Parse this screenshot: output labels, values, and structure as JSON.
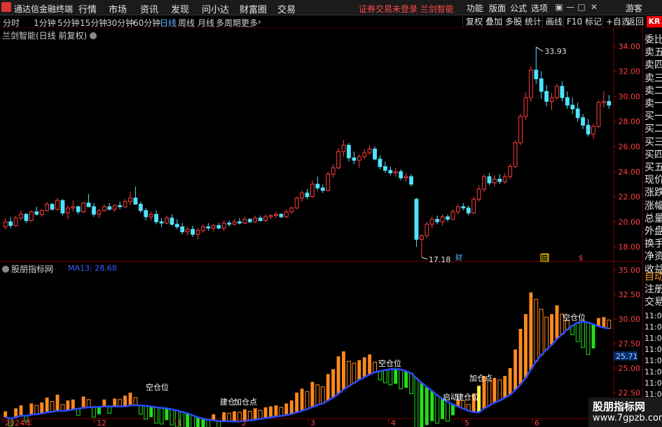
{
  "menubar": {
    "app_title": "通达信金融终端",
    "menus": [
      "行情",
      "市场",
      "资讯",
      "发现",
      "问小达",
      "财富圈",
      "交易"
    ],
    "status": "证券交易未登录  兰剑智能",
    "right_menus": [
      "功能",
      "版面",
      "公式",
      "选项"
    ],
    "user": "游客"
  },
  "periodbar": {
    "periods": [
      "分时",
      "1分钟",
      "5分钟",
      "15分钟",
      "30分钟",
      "60分钟",
      "日线",
      "周线",
      "月线",
      "多周期",
      "更多"
    ],
    "active_period": "日线",
    "tools": [
      "复权",
      "叠加",
      "多股",
      "统计",
      "画线",
      "F10",
      "标记",
      "+自选",
      "返回"
    ],
    "badge": "KR"
  },
  "main_panel": {
    "title": "兰剑智能(日线 前复权)"
  },
  "indicator_panel": {
    "title": "股朋指标网",
    "ma_label": "MA13: 28.68"
  },
  "chart_data": [
    {
      "type": "candlestick",
      "title": "兰剑智能(日线 前复权)",
      "ylim": [
        17,
        35
      ],
      "y_ticks": [
        "34.00",
        "32.00",
        "30.00",
        "28.00",
        "26.00",
        "24.00",
        "22.00",
        "20.00",
        "18.00"
      ],
      "y_tick_values": [
        34,
        32,
        30,
        28,
        26,
        24,
        22,
        20,
        18
      ],
      "annotations": [
        {
          "text": "33.93",
          "value": 33.93
        },
        {
          "text": "17.18",
          "value": 17.18
        }
      ],
      "markers": [
        "财",
        "回",
        "$"
      ],
      "candles": [
        [
          19.6,
          20.3,
          19.4,
          20.0
        ],
        [
          20.0,
          20.4,
          19.5,
          19.7
        ],
        [
          19.7,
          20.5,
          19.6,
          20.3
        ],
        [
          20.3,
          20.9,
          20.1,
          20.6
        ],
        [
          20.6,
          20.7,
          19.9,
          20.1
        ],
        [
          20.1,
          20.9,
          20.0,
          20.8
        ],
        [
          20.8,
          21.2,
          20.5,
          20.6
        ],
        [
          20.6,
          21.0,
          20.4,
          20.9
        ],
        [
          20.9,
          21.6,
          20.8,
          21.4
        ],
        [
          21.4,
          21.5,
          20.9,
          21.0
        ],
        [
          21.0,
          21.9,
          20.9,
          21.7
        ],
        [
          21.7,
          21.8,
          20.5,
          20.7
        ],
        [
          20.7,
          21.3,
          20.2,
          21.1
        ],
        [
          21.1,
          21.7,
          20.8,
          21.2
        ],
        [
          21.2,
          21.3,
          20.6,
          20.8
        ],
        [
          20.8,
          21.6,
          20.7,
          21.5
        ],
        [
          21.5,
          22.2,
          21.2,
          21.2
        ],
        [
          21.2,
          21.5,
          20.4,
          20.6
        ],
        [
          20.6,
          21.0,
          20.3,
          20.9
        ],
        [
          20.9,
          21.4,
          20.8,
          21.2
        ],
        [
          21.2,
          21.5,
          20.9,
          21.0
        ],
        [
          21.0,
          21.4,
          20.8,
          21.3
        ],
        [
          21.3,
          21.6,
          21.0,
          21.2
        ],
        [
          21.2,
          21.8,
          21.1,
          21.6
        ],
        [
          21.6,
          22.4,
          21.3,
          21.9
        ],
        [
          21.9,
          22.8,
          21.5,
          21.4
        ],
        [
          21.4,
          21.6,
          20.7,
          20.9
        ],
        [
          20.9,
          21.1,
          20.1,
          20.4
        ],
        [
          20.4,
          20.8,
          20.1,
          20.6
        ],
        [
          20.6,
          20.9,
          19.8,
          20.0
        ],
        [
          20.0,
          20.3,
          19.6,
          19.9
        ],
        [
          19.9,
          20.5,
          19.8,
          20.3
        ],
        [
          20.3,
          20.6,
          19.7,
          19.8
        ],
        [
          19.8,
          20.2,
          19.4,
          19.6
        ],
        [
          19.6,
          19.9,
          19.0,
          19.2
        ],
        [
          19.2,
          19.6,
          18.9,
          19.4
        ],
        [
          19.4,
          19.7,
          18.8,
          19.0
        ],
        [
          19.0,
          19.5,
          18.6,
          19.3
        ],
        [
          19.3,
          19.8,
          19.1,
          19.6
        ],
        [
          19.6,
          19.9,
          19.3,
          19.5
        ],
        [
          19.5,
          19.8,
          19.2,
          19.7
        ],
        [
          19.7,
          19.9,
          19.4,
          19.5
        ],
        [
          19.5,
          20.1,
          19.3,
          19.9
        ],
        [
          19.9,
          20.1,
          19.6,
          19.8
        ],
        [
          19.8,
          20.2,
          19.7,
          20.0
        ],
        [
          20.0,
          20.3,
          19.8,
          19.9
        ],
        [
          19.9,
          20.4,
          19.8,
          20.2
        ],
        [
          20.2,
          20.3,
          19.9,
          20.0
        ],
        [
          20.0,
          20.5,
          19.9,
          20.3
        ],
        [
          20.3,
          20.5,
          20.0,
          20.1
        ],
        [
          20.1,
          20.6,
          20.0,
          20.4
        ],
        [
          20.4,
          20.6,
          20.2,
          20.5
        ],
        [
          20.5,
          20.8,
          20.3,
          20.6
        ],
        [
          20.6,
          20.7,
          20.3,
          20.4
        ],
        [
          20.4,
          21.0,
          20.3,
          20.8
        ],
        [
          20.8,
          21.2,
          20.6,
          21.1
        ],
        [
          21.1,
          22.0,
          21.0,
          21.9
        ],
        [
          21.9,
          22.5,
          21.6,
          22.3
        ],
        [
          22.3,
          22.6,
          21.8,
          22.0
        ],
        [
          22.0,
          23.3,
          21.9,
          23.0
        ],
        [
          23.0,
          23.6,
          22.5,
          22.7
        ],
        [
          22.7,
          23.0,
          22.3,
          22.5
        ],
        [
          22.5,
          24.0,
          22.4,
          23.8
        ],
        [
          23.8,
          24.6,
          23.5,
          24.3
        ],
        [
          24.3,
          25.9,
          24.2,
          25.6
        ],
        [
          25.6,
          26.5,
          25.2,
          26.1
        ],
        [
          26.1,
          26.3,
          24.8,
          25.1
        ],
        [
          25.1,
          25.6,
          24.6,
          24.9
        ],
        [
          24.9,
          25.4,
          24.3,
          25.2
        ],
        [
          25.2,
          25.8,
          25.0,
          25.5
        ],
        [
          25.5,
          26.1,
          25.3,
          25.8
        ],
        [
          25.8,
          26.0,
          24.9,
          25.0
        ],
        [
          25.0,
          25.3,
          24.2,
          24.4
        ],
        [
          24.4,
          24.8,
          23.9,
          24.1
        ],
        [
          24.1,
          24.4,
          23.7,
          23.9
        ],
        [
          23.9,
          24.3,
          23.6,
          24.0
        ],
        [
          24.0,
          24.2,
          23.3,
          23.5
        ],
        [
          23.5,
          23.9,
          23.2,
          23.6
        ],
        [
          23.6,
          23.8,
          22.8,
          23.0
        ],
        [
          21.8,
          21.9,
          18.0,
          18.6
        ],
        [
          18.6,
          19.0,
          17.18,
          18.9
        ],
        [
          18.9,
          20.0,
          18.7,
          19.8
        ],
        [
          19.8,
          20.4,
          19.5,
          20.2
        ],
        [
          20.2,
          20.5,
          19.8,
          20.0
        ],
        [
          20.0,
          20.6,
          19.7,
          20.4
        ],
        [
          20.4,
          20.6,
          20.0,
          20.2
        ],
        [
          20.2,
          21.0,
          20.1,
          20.8
        ],
        [
          20.8,
          21.4,
          20.6,
          21.2
        ],
        [
          21.2,
          21.5,
          20.9,
          21.1
        ],
        [
          21.1,
          21.3,
          20.5,
          20.7
        ],
        [
          20.7,
          22.0,
          20.6,
          21.8
        ],
        [
          21.8,
          22.9,
          21.6,
          22.6
        ],
        [
          22.6,
          23.8,
          22.4,
          23.6
        ],
        [
          23.6,
          23.9,
          22.9,
          23.1
        ],
        [
          23.1,
          23.7,
          22.8,
          23.4
        ],
        [
          23.4,
          23.8,
          23.0,
          23.2
        ],
        [
          23.2,
          23.9,
          23.0,
          23.6
        ],
        [
          23.6,
          24.6,
          23.4,
          24.4
        ],
        [
          24.4,
          26.5,
          24.3,
          26.3
        ],
        [
          26.3,
          28.6,
          26.1,
          28.4
        ],
        [
          28.4,
          30.3,
          28.1,
          29.9
        ],
        [
          29.9,
          32.4,
          29.6,
          32.1
        ],
        [
          32.1,
          33.93,
          31.0,
          31.4
        ],
        [
          31.4,
          32.0,
          29.8,
          30.4
        ],
        [
          30.4,
          30.9,
          29.2,
          29.6
        ],
        [
          29.6,
          30.3,
          28.9,
          29.9
        ],
        [
          29.9,
          31.0,
          29.7,
          30.8
        ],
        [
          30.8,
          31.2,
          29.6,
          29.9
        ],
        [
          29.9,
          30.4,
          29.0,
          29.3
        ],
        [
          29.3,
          29.9,
          28.6,
          29.0
        ],
        [
          29.0,
          29.5,
          28.0,
          28.3
        ],
        [
          28.3,
          28.6,
          27.4,
          27.7
        ],
        [
          27.7,
          28.2,
          26.8,
          27.0
        ],
        [
          27.0,
          27.8,
          26.6,
          27.6
        ],
        [
          27.6,
          29.7,
          27.5,
          29.5
        ],
        [
          29.5,
          30.4,
          29.1,
          29.6
        ],
        [
          29.6,
          30.1,
          29.0,
          29.3
        ]
      ]
    },
    {
      "type": "bar",
      "title": "股朋指标网",
      "ylim": [
        20,
        35
      ],
      "y_ticks": [
        "35.00",
        "32.50",
        "30.00",
        "27.50",
        "25.00",
        "22.50",
        "20.00"
      ],
      "y_tick_values": [
        35,
        32.5,
        30,
        27.5,
        25,
        22.5,
        20
      ],
      "current_value_label": "25.71",
      "x_tick_labels": [
        "2024年",
        "12",
        "1",
        "2",
        "3",
        "4",
        "5",
        "6"
      ],
      "series": [
        {
          "name": "MA13",
          "value": 28.68
        }
      ],
      "annotations": [
        "空仓位",
        "建仓",
        "加仓点",
        "空仓位",
        "启动",
        "建仓位",
        "加仓点",
        "空仓位"
      ]
    }
  ],
  "sidepanel": {
    "top_items": [
      "委比",
      "卖五",
      "卖四",
      "卖三",
      "卖二",
      "卖一",
      "买一",
      "买二",
      "买三",
      "买四",
      "买五",
      "现价",
      "涨跌",
      "涨幅",
      "总量",
      "外盘",
      "换手",
      "净资",
      "收益"
    ],
    "bottom_items": [
      "自动",
      "注册",
      "交易"
    ],
    "times": [
      "11:03",
      "11:04",
      "11:04",
      "11:05",
      "11:05",
      "11:05",
      "11:05",
      "11:05",
      "11:05"
    ]
  },
  "watermark": {
    "line1": "股朋指标网",
    "line2": "www.7gpzb.com"
  },
  "colors": {
    "up": "#ff3c3c",
    "down": "#4fe3ff",
    "ma": "#2a4bff",
    "orange_bar": "#ff8a1f",
    "green_bar": "#22e01a",
    "yellow_bar": "#ffff3a"
  }
}
